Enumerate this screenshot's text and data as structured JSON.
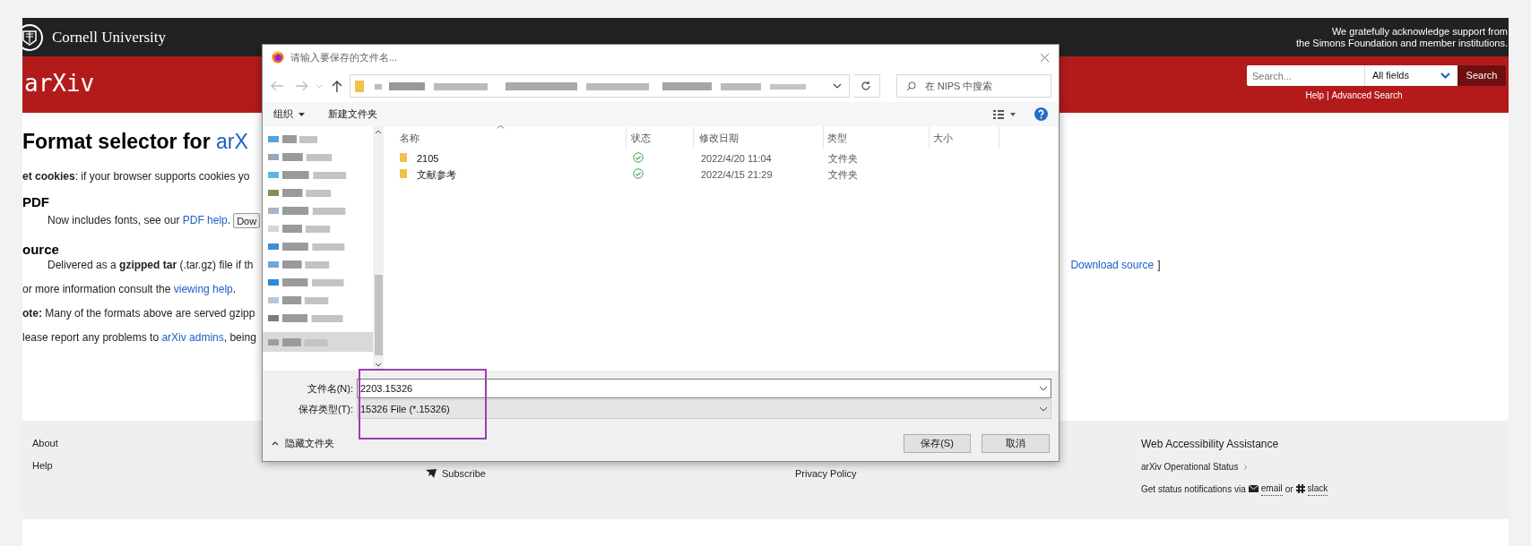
{
  "header": {
    "institution": "Cornell University",
    "support_lines": [
      "We gratefully acknowledge support from",
      "the Simons Foundation and member institutions."
    ]
  },
  "arxiv_bar": {
    "logo": "arXiv",
    "search": {
      "placeholder": "Search...",
      "field": "All fields",
      "button": "Search"
    },
    "links": [
      "Help",
      "Advanced Search"
    ],
    "separator": "|"
  },
  "content": {
    "title": "Format selector for ",
    "title_link": "arX",
    "paragraphs": [
      {
        "kind": "text",
        "segments": [
          {
            "kind": "bold",
            "text": "et cookies"
          },
          {
            "kind": "text",
            "text": ": if your browser supports cookies yo"
          }
        ]
      },
      {
        "kind": "heading",
        "segments": [
          {
            "kind": "text",
            "text": "PDF"
          }
        ]
      },
      {
        "kind": "indent",
        "segments": [
          {
            "kind": "text",
            "text": "Now includes fonts, see our "
          },
          {
            "kind": "link",
            "text": "PDF help"
          },
          {
            "kind": "text",
            "text": "."
          }
        ],
        "button": "Dow"
      },
      {
        "kind": "heading",
        "segments": [
          {
            "kind": "text",
            "text": "ource"
          }
        ]
      },
      {
        "kind": "indent",
        "segments": [
          {
            "kind": "text",
            "text": "Delivered as a "
          },
          {
            "kind": "bold",
            "text": "gzipped tar"
          },
          {
            "kind": "text",
            "text": " (.tar.gz) file if th"
          }
        ],
        "side_link": "Download source",
        "side_text": "]"
      },
      {
        "kind": "text",
        "segments": [
          {
            "kind": "text",
            "text": "or more information consult the "
          },
          {
            "kind": "link",
            "text": "viewing help"
          },
          {
            "kind": "text",
            "text": "."
          }
        ]
      },
      {
        "kind": "text",
        "segments": [
          {
            "kind": "bold",
            "text": "ote:"
          },
          {
            "kind": "text",
            "text": " Many of the formats above are served gzipp"
          }
        ]
      },
      {
        "kind": "text",
        "segments": [
          {
            "kind": "text",
            "text": "lease report any problems to "
          },
          {
            "kind": "link",
            "text": "arXiv admins"
          },
          {
            "kind": "text",
            "text": ", being"
          }
        ]
      }
    ]
  },
  "footer": {
    "links": [
      "About",
      "Help"
    ],
    "subscribe": "Subscribe",
    "privacy": "Privacy Policy",
    "accessibility": "Web Accessibility Assistance",
    "status": "arXiv Operational Status",
    "notify_text": "Get status notifications via",
    "email": "email",
    "or": "or",
    "slack": "slack"
  },
  "dialog": {
    "title": "请输入要保存的文件名...",
    "search_placeholder": "在 NIPS 中搜索",
    "toolbar": [
      "组织",
      "新建文件夹"
    ],
    "columns": [
      "名称",
      "状态",
      "修改日期",
      "类型",
      "大小"
    ],
    "rows": [
      {
        "name": "2105",
        "modified": "2022/4/20 11:04",
        "type": "文件夹",
        "selected": false
      },
      {
        "name": "文献参考",
        "modified": "2022/4/15 21:29",
        "type": "文件夹",
        "selected": false
      }
    ],
    "filename_label": "文件名(N):",
    "filename": "2203.15326",
    "filetype_label": "保存类型(T):",
    "filetype": "15326 File (*.15326)",
    "hide_folders": "隐藏文件夹",
    "buttons": [
      "保存(S)",
      "取消"
    ]
  }
}
